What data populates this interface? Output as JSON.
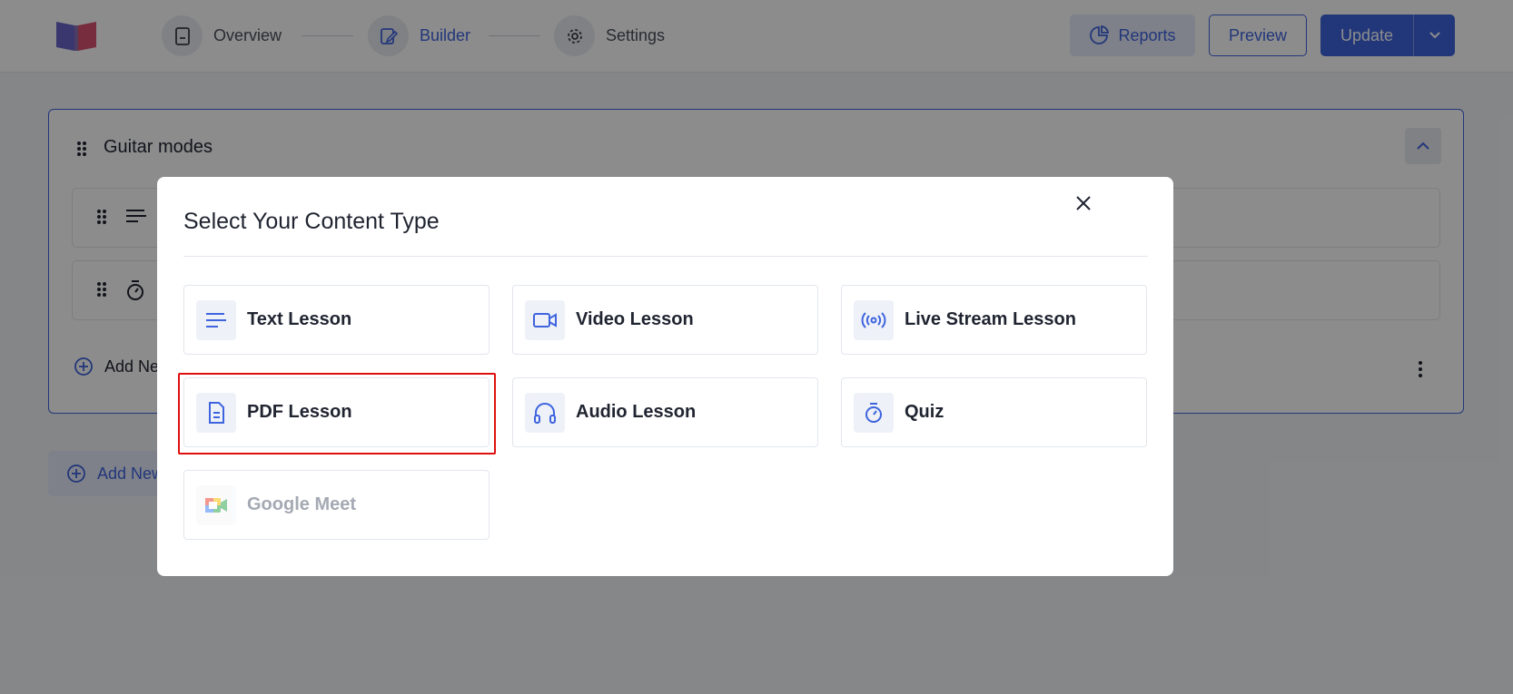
{
  "colors": {
    "accent": "#3e64de",
    "highlight": "#e00f0f"
  },
  "header": {
    "logo_icon": "book-icon",
    "steps": [
      {
        "label": "Overview",
        "icon": "document-icon"
      },
      {
        "label": "Builder",
        "icon": "edit-icon"
      },
      {
        "label": "Settings",
        "icon": "gear-icon"
      }
    ],
    "reports_label": "Reports",
    "preview_label": "Preview",
    "update_label": "Update"
  },
  "topic": {
    "title": "Guitar modes",
    "lessons": [
      {
        "icon": "text-lines-icon"
      },
      {
        "icon": "stopwatch-icon"
      }
    ],
    "add_lesson_label": "Add Ne",
    "add_topic_label": "Add New"
  },
  "modal": {
    "title": "Select Your Content Type",
    "options": [
      {
        "label": "Text Lesson",
        "icon": "text-lines-icon"
      },
      {
        "label": "Video Lesson",
        "icon": "video-camera-icon"
      },
      {
        "label": "Live Stream Lesson",
        "icon": "broadcast-icon"
      },
      {
        "label": "PDF Lesson",
        "icon": "pdf-document-icon"
      },
      {
        "label": "Audio Lesson",
        "icon": "headphones-icon"
      },
      {
        "label": "Quiz",
        "icon": "stopwatch-icon"
      },
      {
        "label": "Google Meet",
        "icon": "google-meet-icon",
        "disabled": true
      }
    ]
  }
}
